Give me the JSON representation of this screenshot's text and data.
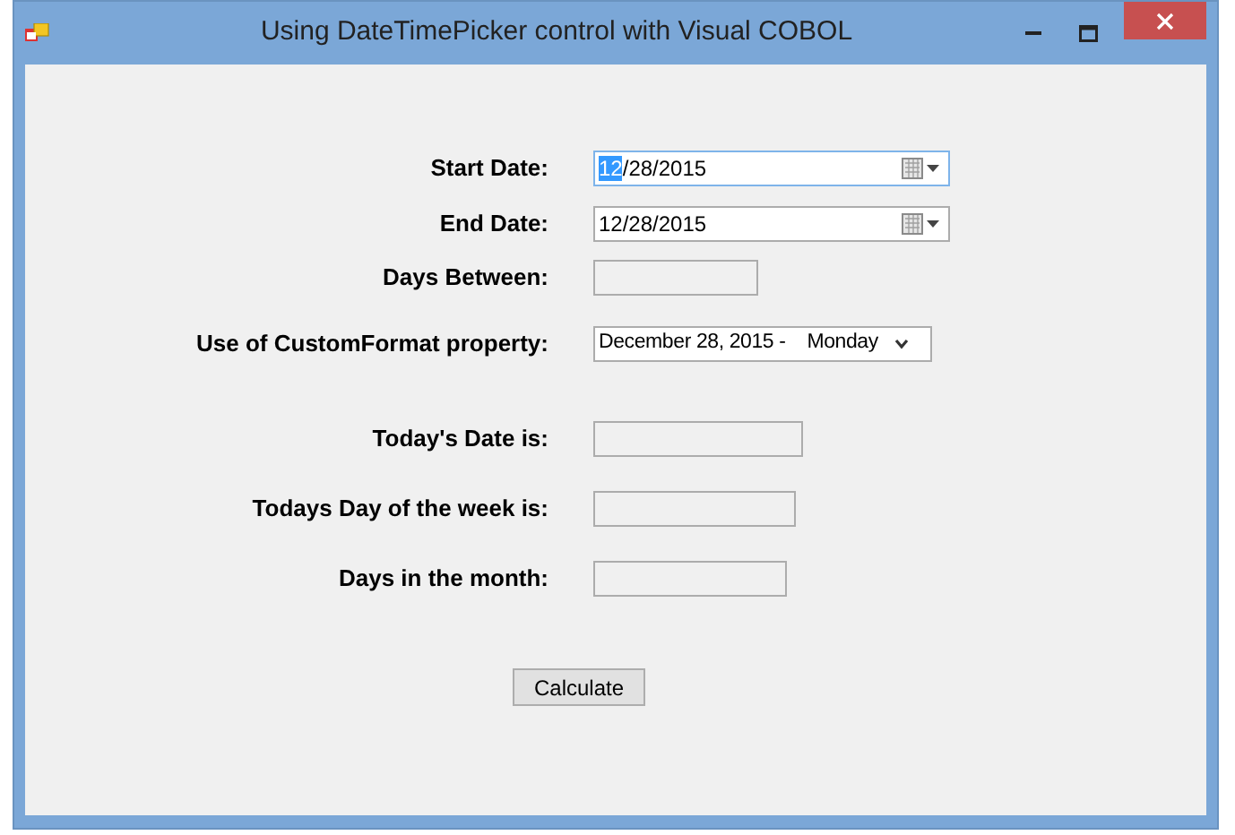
{
  "window": {
    "title": "Using DateTimePicker control with Visual COBOL"
  },
  "fields": [
    {
      "label": "Start Date:",
      "kind": "datepicker",
      "focused": true,
      "parts": [
        {
          "text": "12",
          "selected": true
        },
        {
          "text": "/28/2015",
          "selected": false
        }
      ]
    },
    {
      "label": "End Date:",
      "kind": "datepicker",
      "focused": false,
      "parts": [
        {
          "text": "12/28/2015",
          "selected": false
        }
      ]
    },
    {
      "label": "Days Between:",
      "kind": "textbox"
    },
    {
      "label": "Use of CustomFormat property:",
      "kind": "dropdown",
      "value": "December 28, 2015 -    Monday"
    },
    {
      "label": "Today's Date is:",
      "kind": "textbox"
    },
    {
      "label": "Todays Day of the week is:",
      "kind": "textbox"
    },
    {
      "label": "Days in the month:",
      "kind": "textbox"
    }
  ],
  "button": "Calculate"
}
